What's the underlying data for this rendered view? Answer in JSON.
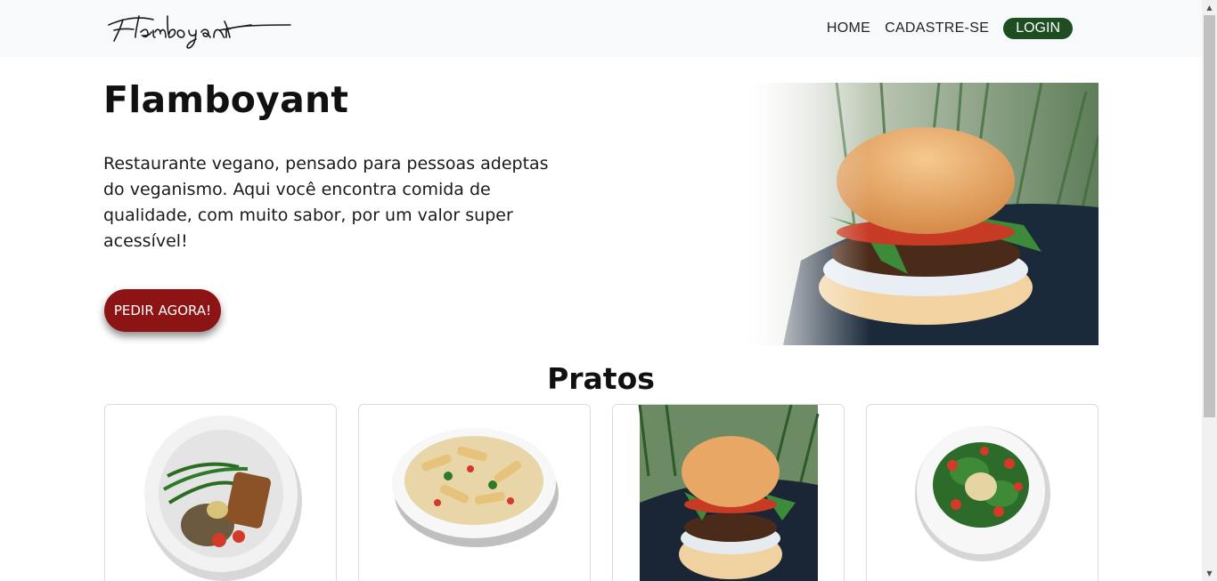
{
  "nav": {
    "logo_text": "Flamboyant",
    "links": [
      "HOME",
      "CADASTRE-SE"
    ],
    "login_label": "LOGIN"
  },
  "hero": {
    "title": "Flamboyant",
    "description": "Restaurante vegano, pensado para pessoas adeptas do veganismo. Aqui você encontra comida de qualidade, com muito sabor, por um valor super acessível!",
    "cta_label": "PEDIR AGORA!"
  },
  "section": {
    "title": "Pratos"
  },
  "colors": {
    "navbar_bg": "#f8f9fa",
    "login_bg": "#1e4d22",
    "cta_bg": "#8c1414"
  },
  "icons": {
    "scroll_up": "chevron-up-icon",
    "scroll_down": "chevron-down-icon"
  }
}
